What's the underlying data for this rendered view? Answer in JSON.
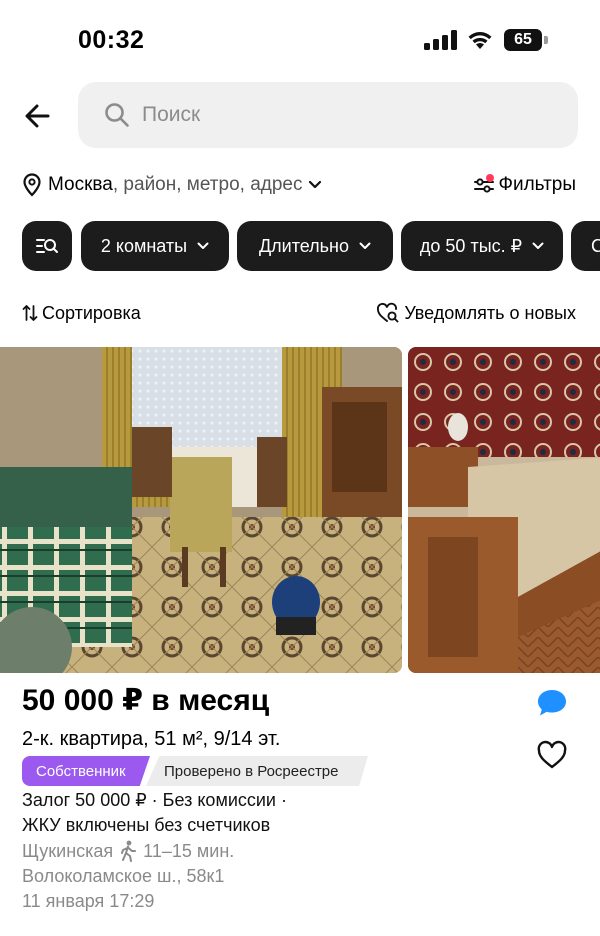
{
  "status_bar": {
    "time": "00:32",
    "battery": "65"
  },
  "search": {
    "placeholder": "Поиск"
  },
  "location": {
    "city": "Москва",
    "rest": ", район, метро, адрес"
  },
  "filters": {
    "label": "Фильтры",
    "indicator_color": "#ff3b5c"
  },
  "chips": [
    {
      "label": "",
      "icon": "search-filters-icon"
    },
    {
      "label": "2 комнаты"
    },
    {
      "label": "Длительно"
    },
    {
      "label": "до 50 тыс. ₽"
    },
    {
      "label": "С"
    }
  ],
  "sort": {
    "label": "Сортировка"
  },
  "notify": {
    "label": "Уведомлять о новых"
  },
  "listing": {
    "price": "50 000 ₽ в месяц",
    "title": "2-к. квартира, 51 м², 9/14 эт.",
    "badge_owner": "Собственник",
    "badge_verified": "Проверено в Росреестре",
    "terms_1": "Залог 50 000 ₽ · Без комиссии ·",
    "terms_2": "ЖКУ включены без счетчиков",
    "metro_station": "Щукинская",
    "metro_time": "11–15 мин.",
    "address": "Волоколамское ш., 58к1",
    "date": "11 января 17:29"
  },
  "colors": {
    "accent_purple": "#9b59f0",
    "chat_blue": "#1e90ff",
    "chip_bg": "#1c1c1c"
  }
}
